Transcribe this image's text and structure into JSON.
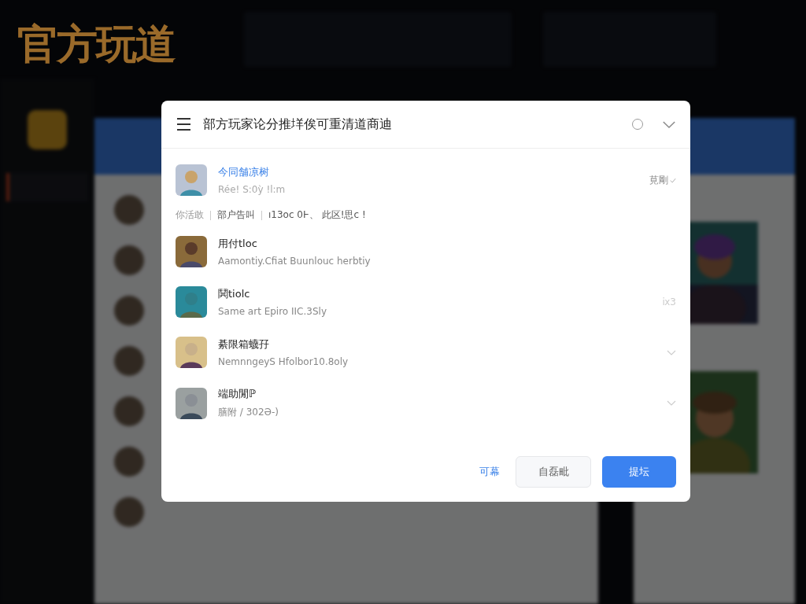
{
  "app": {
    "logo": "官方玩道"
  },
  "dialog": {
    "title": "部方玩家论分推垟俟可重清道商迪",
    "featured": {
      "name": "今同舗凉树",
      "subtitle": "Rée! S:0ỳ !l:m",
      "status": "莧剛"
    },
    "meta": [
      "你活敢",
      "部户告叫",
      "ı13oc 0Ͱ、 此区!思c !"
    ],
    "rows": [
      {
        "name": "用付tloc",
        "subtitle": "Aamontiy.Cfiat Buunlouc herbtiy",
        "kind": "plain"
      },
      {
        "name": "鬨tiolc",
        "subtitle": "Same art Epiro IIC.3Sly",
        "kind": "count",
        "count": "ⅸ3"
      },
      {
        "name": "綦限箱蠛孖",
        "subtitle": "NemnngeyS Hfolbor10.8oly",
        "kind": "chevron"
      },
      {
        "name": "端助閒ℙ",
        "subtitle": "膳附 / 302Ə-)",
        "kind": "chevron"
      }
    ],
    "buttons": [
      {
        "label": "可幕",
        "kind": "link"
      },
      {
        "label": "自磊毗",
        "kind": "secondary"
      },
      {
        "label": "提坛",
        "kind": "primary"
      }
    ]
  }
}
